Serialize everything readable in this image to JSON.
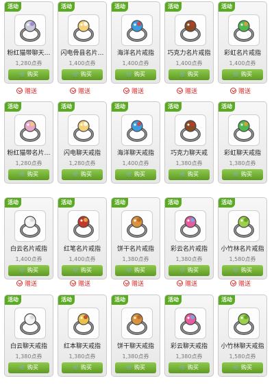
{
  "colors": {
    "badge": "#5aaa22",
    "buy_button": "#6aa82e",
    "gift_text": "#d42b2b"
  },
  "rows": [
    {
      "items": [
        {
          "badge": "活动",
          "name": "粉红猫带聊天…",
          "price": "1,280点券",
          "buy": "购买",
          "gem": "#c8c8d8",
          "gem2": "#9a7bd8"
        },
        {
          "badge": "活动",
          "name": "闪电骨县名片…",
          "price": "1,400点券",
          "buy": "购买",
          "gem": "#f5d27a",
          "gem2": "#ffffff"
        },
        {
          "badge": "活动",
          "name": "海洋名片戒指",
          "price": "1,400点券",
          "buy": "购买",
          "gem": "#3a9de0",
          "gem2": "#e23a3a"
        },
        {
          "badge": "活动",
          "name": "巧克力名片戒指",
          "price": "1,400点券",
          "buy": "购买",
          "gem": "#8a4a22",
          "gem2": "#c0392b"
        },
        {
          "badge": "活动",
          "name": "彩虹名片戒指",
          "price": "1,400点券",
          "buy": "购买",
          "gem": "#4fb84f",
          "gem2": "#e2a13a"
        }
      ],
      "gifts": [
        "赠送",
        "赠送",
        "赠送",
        "赠送",
        "赠送"
      ]
    },
    {
      "items": [
        {
          "badge": "活动",
          "name": "粉红猫带名片…",
          "price": "1,280点券",
          "buy": "购买",
          "gem": "#e8a6c8",
          "gem2": "#f0d070"
        },
        {
          "badge": "活动",
          "name": "闪电聊天戒指",
          "price": "1,280点券",
          "buy": "购买",
          "gem": "#f5d27a",
          "gem2": "#ffffff"
        },
        {
          "badge": "活动",
          "name": "海洋聊天戒指",
          "price": "1,400点券",
          "buy": "购买",
          "gem": "#3a9de0",
          "gem2": "#e23a3a"
        },
        {
          "badge": "活动",
          "name": "巧克力聊天戒",
          "price": "1,380点券",
          "buy": "购买",
          "gem": "#8a4a22",
          "gem2": "#c0392b"
        },
        {
          "badge": "活动",
          "name": "彩虹聊天戒指",
          "price": "1,380点券",
          "buy": "购买",
          "gem": "#4fb84f",
          "gem2": "#e2a13a"
        }
      ],
      "gifts": []
    },
    {
      "items": [
        {
          "badge": "活动",
          "name": "白云名片戒指",
          "price": "1,400点券",
          "buy": "购买",
          "gem": "#f4f4f4",
          "gem2": "#cfd6e0"
        },
        {
          "badge": "活动",
          "name": "红笔名片戒指",
          "price": "1,400点券",
          "buy": "购买",
          "gem": "#c0392b",
          "gem2": "#e8b04a"
        },
        {
          "badge": "活动",
          "name": "饼干名片戒指",
          "price": "1,380点券",
          "buy": "购买",
          "gem": "#d9933e",
          "gem2": "#b5651d"
        },
        {
          "badge": "活动",
          "name": "彩云名片戒指",
          "price": "1,380点券",
          "buy": "购买",
          "gem": "#e65c9e",
          "gem2": "#6ab0e6"
        },
        {
          "badge": "活动",
          "name": "小竹林名片戒指",
          "price": "1,580点券",
          "buy": "购买",
          "gem": "#9ad04a",
          "gem2": "#5a9a22"
        }
      ],
      "gifts": [
        "赠送",
        "赠送",
        "赠送",
        "赠送",
        "赠送"
      ]
    },
    {
      "items": [
        {
          "badge": "活动",
          "name": "白云聊天戒指",
          "price": "1,380点券",
          "buy": "购买",
          "gem": "#f4f4f4",
          "gem2": "#cfd6e0"
        },
        {
          "badge": "活动",
          "name": "红本聊天戒指",
          "price": "1,380点券",
          "buy": "购买",
          "gem": "#e8c24a",
          "gem2": "#c0392b"
        },
        {
          "badge": "活动",
          "name": "饼干聊天戒指",
          "price": "1,380点券",
          "buy": "购买",
          "gem": "#d9933e",
          "gem2": "#b5651d"
        },
        {
          "badge": "活动",
          "name": "彩云聊天戒指",
          "price": "1,380点券",
          "buy": "购买",
          "gem": "#e65c9e",
          "gem2": "#6ab0e6"
        },
        {
          "badge": "活动",
          "name": "小竹林聊天戒指",
          "price": "1,580点券",
          "buy": "购买",
          "gem": "#9ad04a",
          "gem2": "#5a9a22"
        }
      ],
      "gifts": []
    }
  ]
}
